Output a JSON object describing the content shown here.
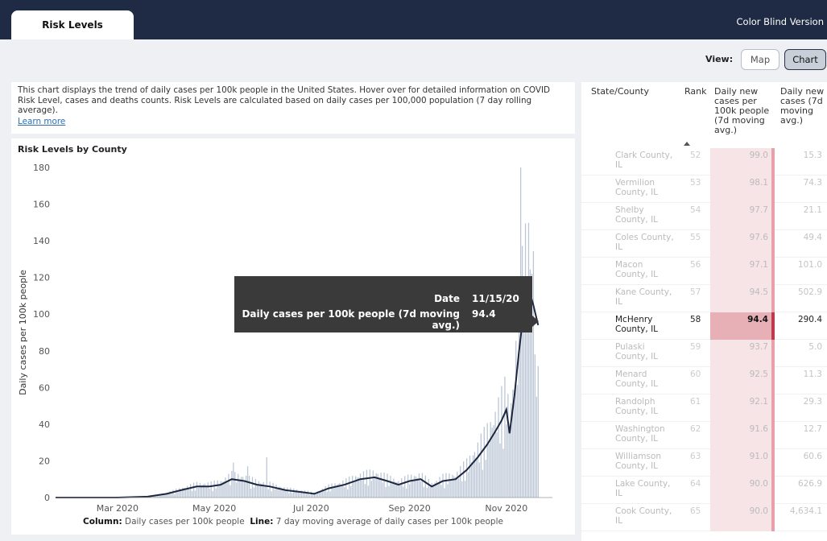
{
  "header": {
    "tab_label": "Risk Levels",
    "color_blind_link": "Color Blind Version"
  },
  "view": {
    "label": "View:",
    "map_button": "Map",
    "chart_button": "Chart",
    "selected": "Chart"
  },
  "description": {
    "text": "This chart displays the trend of daily cases per 100k people in the United States. Hover over for detailed information on COVID Risk Level, cases and deaths counts. Risk Levels are calculated based on daily cases per 100,000 population (7 day rolling average).",
    "learn_more": "Learn more"
  },
  "tooltip": {
    "date_label": "Date",
    "date_value": "11/15/20",
    "metric_label": "Daily cases per 100k people (7d moving avg.)",
    "metric_value": "94.4"
  },
  "legend": {
    "column_label": "Column:",
    "column_text": "Daily cases per 100k people",
    "line_label": "Line:",
    "line_text": "7 day moving average of daily cases per 100k people"
  },
  "chart_data": {
    "type": "bar",
    "title": "Risk Levels by County",
    "ylabel": "Daily cases per 100k people",
    "xlabel": "",
    "ylim": [
      0,
      180
    ],
    "yticks": [
      0,
      20,
      40,
      60,
      80,
      100,
      120,
      140,
      160,
      180
    ],
    "x_ticks": [
      "Mar 2020",
      "May 2020",
      "Jul 2020",
      "Sep 2020",
      "Nov 2020"
    ],
    "grid": false,
    "x_start": "2020-01-22",
    "x_end": "2020-11-30",
    "moving_avg_points": [
      [
        "2020-01-22",
        0
      ],
      [
        "2020-03-01",
        0
      ],
      [
        "2020-03-20",
        0.5
      ],
      [
        "2020-04-01",
        2
      ],
      [
        "2020-04-10",
        4
      ],
      [
        "2020-04-20",
        6
      ],
      [
        "2020-04-28",
        6
      ],
      [
        "2020-05-05",
        7
      ],
      [
        "2020-05-12",
        10
      ],
      [
        "2020-05-20",
        9
      ],
      [
        "2020-05-28",
        7
      ],
      [
        "2020-06-05",
        6
      ],
      [
        "2020-06-15",
        4
      ],
      [
        "2020-06-25",
        3
      ],
      [
        "2020-07-03",
        2
      ],
      [
        "2020-07-12",
        5
      ],
      [
        "2020-07-22",
        7
      ],
      [
        "2020-08-01",
        10
      ],
      [
        "2020-08-10",
        11
      ],
      [
        "2020-08-18",
        9
      ],
      [
        "2020-08-25",
        7
      ],
      [
        "2020-09-01",
        9
      ],
      [
        "2020-09-08",
        10
      ],
      [
        "2020-09-15",
        6
      ],
      [
        "2020-09-22",
        9
      ],
      [
        "2020-09-30",
        10
      ],
      [
        "2020-10-07",
        15
      ],
      [
        "2020-10-14",
        22
      ],
      [
        "2020-10-20",
        29
      ],
      [
        "2020-10-25",
        36
      ],
      [
        "2020-10-29",
        42
      ],
      [
        "2020-11-01",
        48
      ],
      [
        "2020-11-03",
        35
      ],
      [
        "2020-11-06",
        55
      ],
      [
        "2020-11-09",
        80
      ],
      [
        "2020-11-12",
        102
      ],
      [
        "2020-11-15",
        114
      ],
      [
        "2020-11-18",
        105
      ],
      [
        "2020-11-21",
        94
      ]
    ],
    "daily_peaks": [
      [
        "2020-05-13",
        19
      ],
      [
        "2020-05-22",
        17
      ],
      [
        "2020-06-03",
        22
      ],
      [
        "2020-11-10",
        180
      ],
      [
        "2020-11-12",
        108
      ],
      [
        "2020-11-14",
        96
      ],
      [
        "2020-11-17",
        122
      ],
      [
        "2020-11-19",
        78
      ],
      [
        "2020-11-20",
        55
      ]
    ]
  },
  "table": {
    "headers": {
      "name": "State/County",
      "rank": "Rank",
      "rate": "Daily new cases per 100k people (7d moving avg.)",
      "avg": "Daily new cases (7d moving avg.)"
    },
    "rows": [
      {
        "name": "Clark County, IL",
        "rank": "52",
        "rate": "99.0",
        "avg": "15.3"
      },
      {
        "name": "Vermilion County, IL",
        "rank": "53",
        "rate": "98.1",
        "avg": "74.3"
      },
      {
        "name": "Shelby County, IL",
        "rank": "54",
        "rate": "97.7",
        "avg": "21.1"
      },
      {
        "name": "Coles County, IL",
        "rank": "55",
        "rate": "97.6",
        "avg": "49.4"
      },
      {
        "name": "Macon County, IL",
        "rank": "56",
        "rate": "97.1",
        "avg": "101.0"
      },
      {
        "name": "Kane County, IL",
        "rank": "57",
        "rate": "94.5",
        "avg": "502.9"
      },
      {
        "name": "McHenry County, IL",
        "rank": "58",
        "rate": "94.4",
        "avg": "290.4",
        "highlighted": true
      },
      {
        "name": "Pulaski County, IL",
        "rank": "59",
        "rate": "93.7",
        "avg": "5.0"
      },
      {
        "name": "Menard County, IL",
        "rank": "60",
        "rate": "92.5",
        "avg": "11.3"
      },
      {
        "name": "Randolph County, IL",
        "rank": "61",
        "rate": "92.1",
        "avg": "29.3"
      },
      {
        "name": "Washington County, IL",
        "rank": "62",
        "rate": "91.6",
        "avg": "12.7"
      },
      {
        "name": "Williamson County, IL",
        "rank": "63",
        "rate": "91.0",
        "avg": "60.6"
      },
      {
        "name": "Lake County, IL",
        "rank": "64",
        "rate": "90.0",
        "avg": "626.9"
      },
      {
        "name": "Cook County, IL",
        "rank": "65",
        "rate": "90.0",
        "avg": "4,634.1"
      }
    ]
  }
}
